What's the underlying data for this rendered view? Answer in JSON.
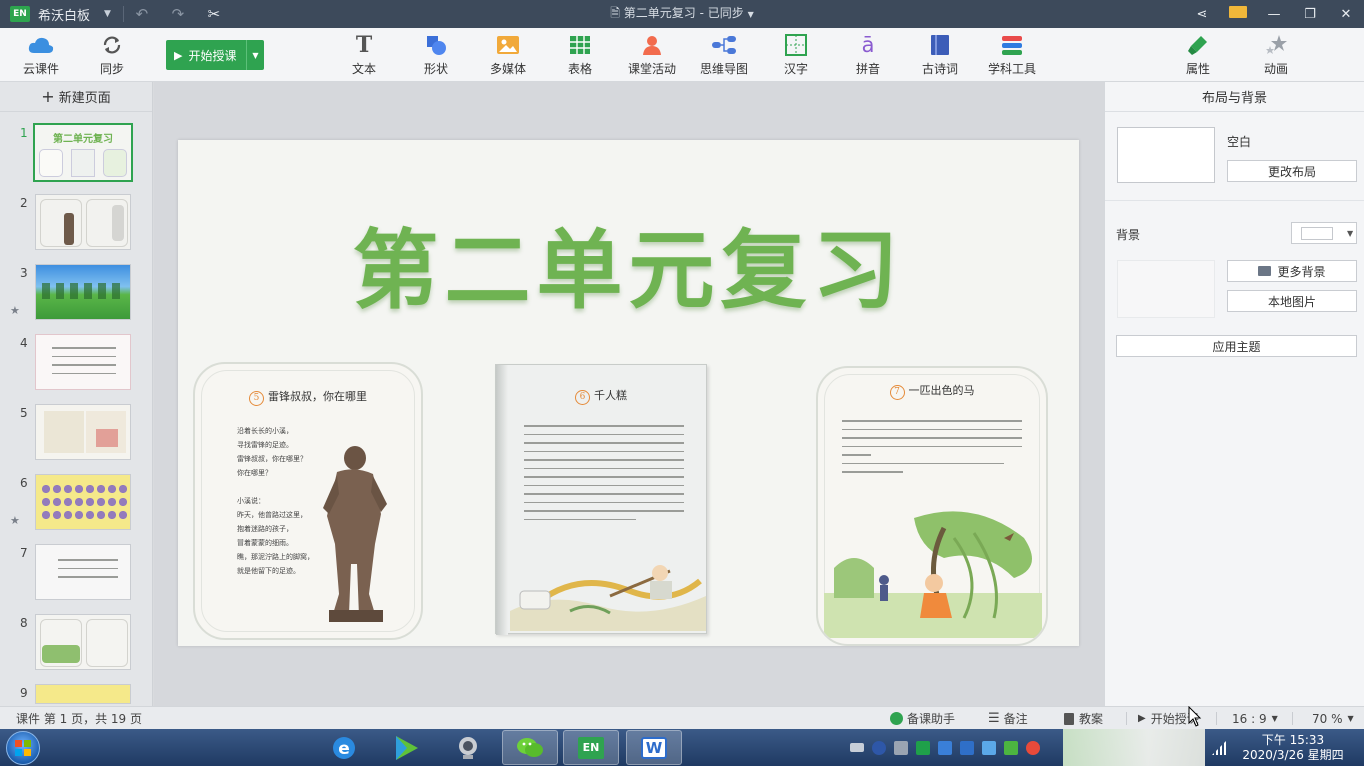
{
  "titlebar": {
    "app_logo": "EN",
    "app_name": "希沃白板",
    "doc_title": "第二单元复习 - 已同步",
    "icons": [
      "undo-icon",
      "redo-icon",
      "scissors-icon",
      "share-icon",
      "mail-icon",
      "minimize-icon",
      "restore-icon",
      "close-icon"
    ]
  },
  "toolbar": {
    "cloud_label": "云课件",
    "sync_label": "同步",
    "start_label": "开始授课",
    "tools": [
      {
        "label": "文本",
        "icon": "text-icon"
      },
      {
        "label": "形状",
        "icon": "shape-icon"
      },
      {
        "label": "多媒体",
        "icon": "media-icon"
      },
      {
        "label": "表格",
        "icon": "table-icon"
      },
      {
        "label": "课堂活动",
        "icon": "activity-icon"
      },
      {
        "label": "思维导图",
        "icon": "mindmap-icon"
      },
      {
        "label": "汉字",
        "icon": "hanzi-icon"
      },
      {
        "label": "拼音",
        "icon": "pinyin-icon"
      },
      {
        "label": "古诗词",
        "icon": "poetry-icon"
      },
      {
        "label": "学科工具",
        "icon": "subject-tools-icon"
      }
    ],
    "properties_label": "属性",
    "animation_label": "动画",
    "colors": {
      "accent": "#2fa350",
      "titlebar": "#3d4a5b"
    }
  },
  "left_panel": {
    "new_page_label": "新建页面",
    "thumbs": [
      {
        "num": "1",
        "selected": true
      },
      {
        "num": "2",
        "selected": false
      },
      {
        "num": "3",
        "selected": false,
        "star": true
      },
      {
        "num": "4",
        "selected": false
      },
      {
        "num": "5",
        "selected": false
      },
      {
        "num": "6",
        "selected": false,
        "star": true
      },
      {
        "num": "7",
        "selected": false
      },
      {
        "num": "8",
        "selected": false
      },
      {
        "num": "9",
        "selected": false
      }
    ],
    "thumb1_title": "第二单元复习"
  },
  "slide": {
    "title": "第二单元复习",
    "cards": [
      {
        "number": "5",
        "title": "雷锋叔叔，你在哪里",
        "poem": "沿着长长的小溪，\n寻找雷锋的足迹。\n雷锋叔叔，你在哪里？\n你在哪里？\n\n小溪说：\n昨天，他曾路过这里，\n抱着迷路的孩子，\n冒着蒙蒙的细雨。\n瞧，那泥泞路上的脚窝，\n就是他留下的足迹。"
      },
      {
        "number": "6",
        "title": "千人糕"
      },
      {
        "number": "7",
        "title": "一匹出色的马"
      }
    ]
  },
  "right_panel": {
    "title": "布局与背景",
    "layout_name": "空白",
    "change_layout": "更改布局",
    "background_label": "背景",
    "more_backgrounds": "更多背景",
    "local_image": "本地图片",
    "apply_theme": "应用主题"
  },
  "statusbar": {
    "page_info": "课件 第 1 页，共 19 页",
    "assistant": "备课助手",
    "notes": "备注",
    "lesson_plan": "教案",
    "start_teaching": "开始授课",
    "ratio": "16 : 9",
    "zoom": "70 %"
  },
  "taskbar": {
    "time": "下午 15:33",
    "date": "2020/3/26 星期四",
    "apps": [
      "ie-icon",
      "media-player-icon",
      "webcam-icon",
      "wechat-icon",
      "easinote-icon",
      "wps-icon"
    ]
  }
}
